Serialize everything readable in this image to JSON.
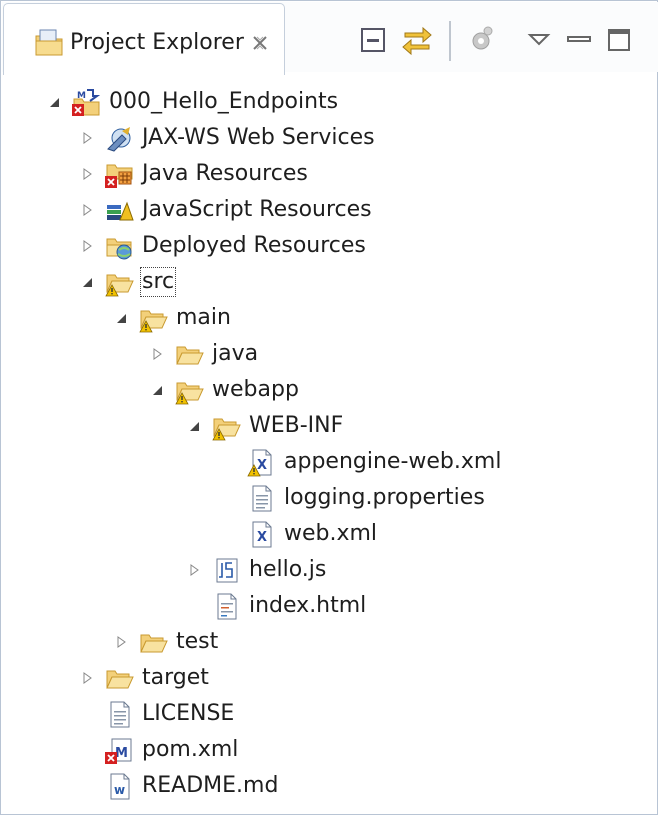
{
  "view": {
    "title": "Project Explorer",
    "close_icon": "close-x-icon",
    "toolbar": [
      {
        "name": "collapse-all-button",
        "icon": "collapse-all-icon"
      },
      {
        "name": "link-with-editor-button",
        "icon": "link-arrows-icon"
      },
      {
        "name": "gear-button",
        "icon": "gear-icon"
      },
      {
        "name": "view-menu-button",
        "icon": "triangle-down-icon"
      },
      {
        "name": "minimize-button",
        "icon": "minimize-icon"
      },
      {
        "name": "maximize-button",
        "icon": "maximize-icon"
      }
    ]
  },
  "tree": [
    {
      "label": "000_Hello_Endpoints",
      "level": 0,
      "toggle": "expanded",
      "icon": "maven-project"
    },
    {
      "label": "JAX-WS Web Services",
      "level": 1,
      "toggle": "collapsed",
      "icon": "jaxws"
    },
    {
      "label": "Java Resources",
      "level": 1,
      "toggle": "collapsed",
      "icon": "java-resources"
    },
    {
      "label": "JavaScript Resources",
      "level": 1,
      "toggle": "collapsed",
      "icon": "js-resources"
    },
    {
      "label": "Deployed Resources",
      "level": 1,
      "toggle": "collapsed",
      "icon": "deployed"
    },
    {
      "label": "src",
      "level": 1,
      "toggle": "expanded",
      "icon": "folder-open-warn",
      "focused": true
    },
    {
      "label": "main",
      "level": 2,
      "toggle": "expanded",
      "icon": "folder-open-warn"
    },
    {
      "label": "java",
      "level": 3,
      "toggle": "collapsed",
      "icon": "folder"
    },
    {
      "label": "webapp",
      "level": 3,
      "toggle": "expanded",
      "icon": "folder-open-warn"
    },
    {
      "label": "WEB-INF",
      "level": 4,
      "toggle": "expanded",
      "icon": "folder-open-warn"
    },
    {
      "label": "appengine-web.xml",
      "level": 5,
      "toggle": "none",
      "icon": "xml-warn"
    },
    {
      "label": "logging.properties",
      "level": 5,
      "toggle": "none",
      "icon": "text-file"
    },
    {
      "label": "web.xml",
      "level": 5,
      "toggle": "none",
      "icon": "xml"
    },
    {
      "label": "hello.js",
      "level": 4,
      "toggle": "collapsed",
      "icon": "js-file"
    },
    {
      "label": "index.html",
      "level": 4,
      "toggle": "none",
      "icon": "html-file"
    },
    {
      "label": "test",
      "level": 2,
      "toggle": "collapsed",
      "icon": "folder"
    },
    {
      "label": "target",
      "level": 1,
      "toggle": "collapsed",
      "icon": "folder"
    },
    {
      "label": "LICENSE",
      "level": 1,
      "toggle": "none",
      "icon": "text-file"
    },
    {
      "label": "pom.xml",
      "level": 1,
      "toggle": "none",
      "icon": "maven-pom"
    },
    {
      "label": "README.md",
      "level": 1,
      "toggle": "none",
      "icon": "word-file"
    }
  ],
  "colors": {
    "folder": "#f3d07a",
    "folder_edge": "#c99a30",
    "warn": "#f2c200",
    "error": "#d42020",
    "arrow": "#444444"
  }
}
